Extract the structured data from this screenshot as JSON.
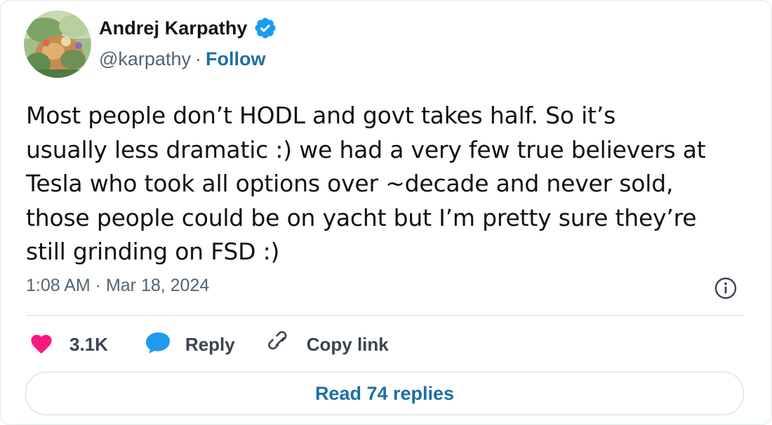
{
  "author": {
    "name": "Andrej Karpathy",
    "handle": "@karpathy",
    "separator": "·",
    "follow_label": "Follow",
    "verified_color": "#1d9bf0"
  },
  "tweet": {
    "lines": [
      "Most people don’t HODL and govt takes half. So it’s",
      "usually less dramatic :) we had a very few true believers at",
      "Tesla who took all options over ~decade and never sold,",
      "those people could be on yacht but I’m pretty sure they’re",
      "still grinding on FSD :)"
    ],
    "timestamp": "1:08 AM · Mar 18, 2024"
  },
  "actions": {
    "like_count": "3.1K",
    "like_color": "#f91880",
    "reply_label": "Reply",
    "reply_color": "#1d9bf0",
    "copy_link_label": "Copy link"
  },
  "footer": {
    "read_replies_label": "Read 74 replies"
  },
  "icons": {
    "verified": "verified-badge-icon",
    "info": "info-icon",
    "like": "heart-icon",
    "reply": "speech-bubble-icon",
    "copy": "link-icon"
  }
}
